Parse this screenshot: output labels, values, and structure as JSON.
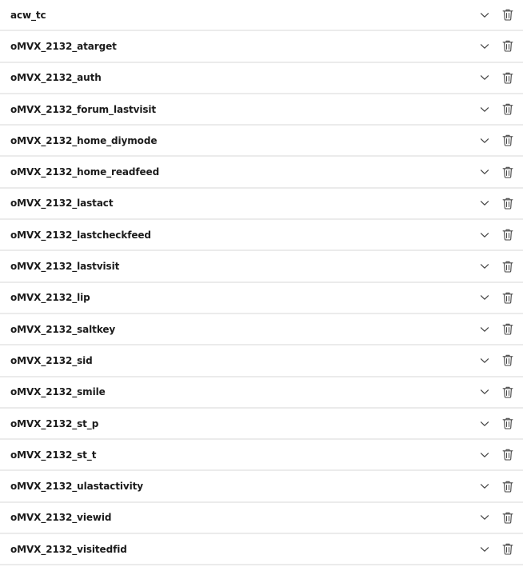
{
  "icons": {
    "expand": "chevron-down-icon",
    "delete": "trash-icon"
  },
  "cookies": [
    {
      "name": "acw_tc"
    },
    {
      "name": "oMVX_2132_atarget"
    },
    {
      "name": "oMVX_2132_auth"
    },
    {
      "name": "oMVX_2132_forum_lastvisit"
    },
    {
      "name": "oMVX_2132_home_diymode"
    },
    {
      "name": "oMVX_2132_home_readfeed"
    },
    {
      "name": "oMVX_2132_lastact"
    },
    {
      "name": "oMVX_2132_lastcheckfeed"
    },
    {
      "name": "oMVX_2132_lastvisit"
    },
    {
      "name": "oMVX_2132_lip"
    },
    {
      "name": "oMVX_2132_saltkey"
    },
    {
      "name": "oMVX_2132_sid"
    },
    {
      "name": "oMVX_2132_smile"
    },
    {
      "name": "oMVX_2132_st_p"
    },
    {
      "name": "oMVX_2132_st_t"
    },
    {
      "name": "oMVX_2132_ulastactivity"
    },
    {
      "name": "oMVX_2132_viewid"
    },
    {
      "name": "oMVX_2132_visitedfid"
    }
  ]
}
